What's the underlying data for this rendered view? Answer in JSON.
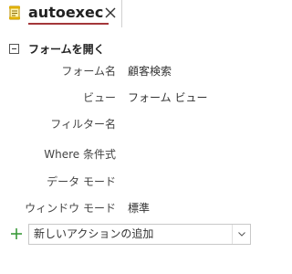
{
  "tab": {
    "title": "autoexec",
    "icon": "macro-icon",
    "close_icon": "close-icon",
    "accent_color": "#a4373a"
  },
  "action": {
    "name": "フォームを開く",
    "collapse_icon": "collapse-minus-icon",
    "arguments": [
      {
        "label": "フォーム名",
        "value": "顧客検索"
      },
      {
        "label": "ビュー",
        "value": "フォーム ビュー"
      },
      {
        "label": "フィルター名",
        "value": ""
      },
      {
        "label": "Where 条件式",
        "value": ""
      },
      {
        "label": "データ モード",
        "value": ""
      },
      {
        "label": "ウィンドウ モード",
        "value": "標準"
      }
    ]
  },
  "new_action": {
    "placeholder": "新しいアクションの追加",
    "add_icon": "plus-icon",
    "add_icon_color": "#3a9a3a",
    "dropdown_icon": "chevron-down-icon"
  }
}
